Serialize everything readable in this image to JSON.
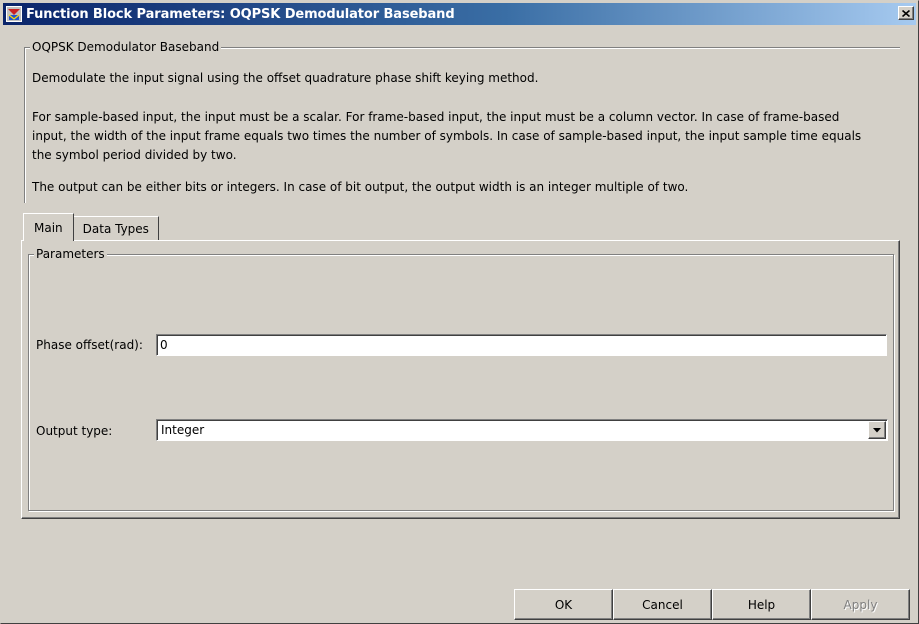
{
  "window": {
    "title": "Function Block Parameters: OQPSK Demodulator Baseband",
    "icon": "simulink-block-icon",
    "close_icon": "close-icon"
  },
  "description_group": {
    "legend": "OQPSK Demodulator Baseband",
    "lines": [
      "Demodulate the input signal using the offset quadrature phase shift keying method.",
      "For sample-based input, the input must be a scalar. For frame-based input, the input must be a column vector. In case of frame-based",
      "input, the width of the input frame equals two times the number of symbols. In case of sample-based input, the input sample time equals",
      "the symbol period divided by two.",
      "The output can be either bits or integers. In case of bit output, the output width is an integer multiple of two."
    ]
  },
  "tabs": [
    {
      "label": "Main",
      "active": true
    },
    {
      "label": "Data Types",
      "active": false
    }
  ],
  "parameters": {
    "legend": "Parameters",
    "phase_offset": {
      "label": "Phase offset(rad):",
      "value": "0"
    },
    "output_type": {
      "label": "Output type:",
      "value": "Integer",
      "arrow_icon": "dropdown-arrow-icon"
    }
  },
  "buttons": {
    "ok": "OK",
    "cancel": "Cancel",
    "help": "Help",
    "apply": "Apply"
  },
  "colors": {
    "dialog_bg": "#d4d0c8",
    "titlebar_start": "#0a246a",
    "titlebar_end": "#a6caf0",
    "disabled_text": "#808080"
  }
}
